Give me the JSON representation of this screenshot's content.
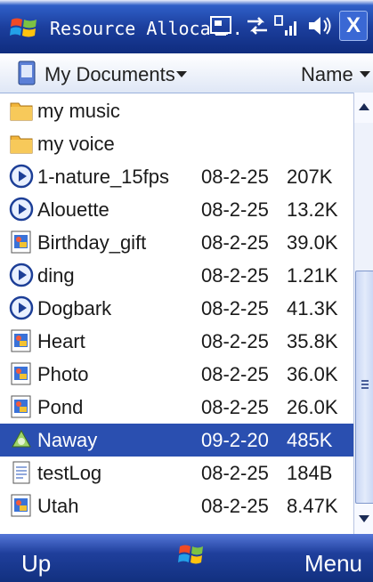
{
  "titlebar": {
    "title": "Resource Alloca...",
    "icons": [
      "windows-start-icon",
      "connectivity-icon",
      "sync-arrows-icon",
      "signal-strength-icon",
      "speaker-icon"
    ],
    "close_label": "X"
  },
  "folderbar": {
    "folder": "My Documents",
    "sort": "Name"
  },
  "files": [
    {
      "name": "my music",
      "date": "",
      "size": "",
      "icon": "folder-icon"
    },
    {
      "name": "my voice",
      "date": "",
      "size": "",
      "icon": "folder-icon"
    },
    {
      "name": "1-nature_15fps",
      "date": "08-2-25",
      "size": "207K",
      "icon": "media-file-icon"
    },
    {
      "name": "Alouette",
      "date": "08-2-25",
      "size": "13.2K",
      "icon": "media-file-icon"
    },
    {
      "name": "Birthday_gift",
      "date": "08-2-25",
      "size": "39.0K",
      "icon": "image-file-icon"
    },
    {
      "name": "ding",
      "date": "08-2-25",
      "size": "1.21K",
      "icon": "media-file-icon"
    },
    {
      "name": "Dogbark",
      "date": "08-2-25",
      "size": "41.3K",
      "icon": "media-file-icon"
    },
    {
      "name": "Heart",
      "date": "08-2-25",
      "size": "35.8K",
      "icon": "image-file-icon"
    },
    {
      "name": "Photo",
      "date": "08-2-25",
      "size": "36.0K",
      "icon": "image-file-icon"
    },
    {
      "name": "Pond",
      "date": "08-2-25",
      "size": "26.0K",
      "icon": "image-file-icon"
    },
    {
      "name": "Naway",
      "date": "09-2-20",
      "size": "485K",
      "icon": "program-icon",
      "selected": true
    },
    {
      "name": "testLog",
      "date": "08-2-25",
      "size": "184B",
      "icon": "text-file-icon"
    },
    {
      "name": "Utah",
      "date": "08-2-25",
      "size": "8.47K",
      "icon": "image-file-icon"
    }
  ],
  "softkeys": {
    "left": "Up",
    "right": "Menu"
  },
  "colors": {
    "titlebar": "#1c3f9e",
    "selection": "#2a4fb0",
    "softbar": "#1f3f9c"
  }
}
